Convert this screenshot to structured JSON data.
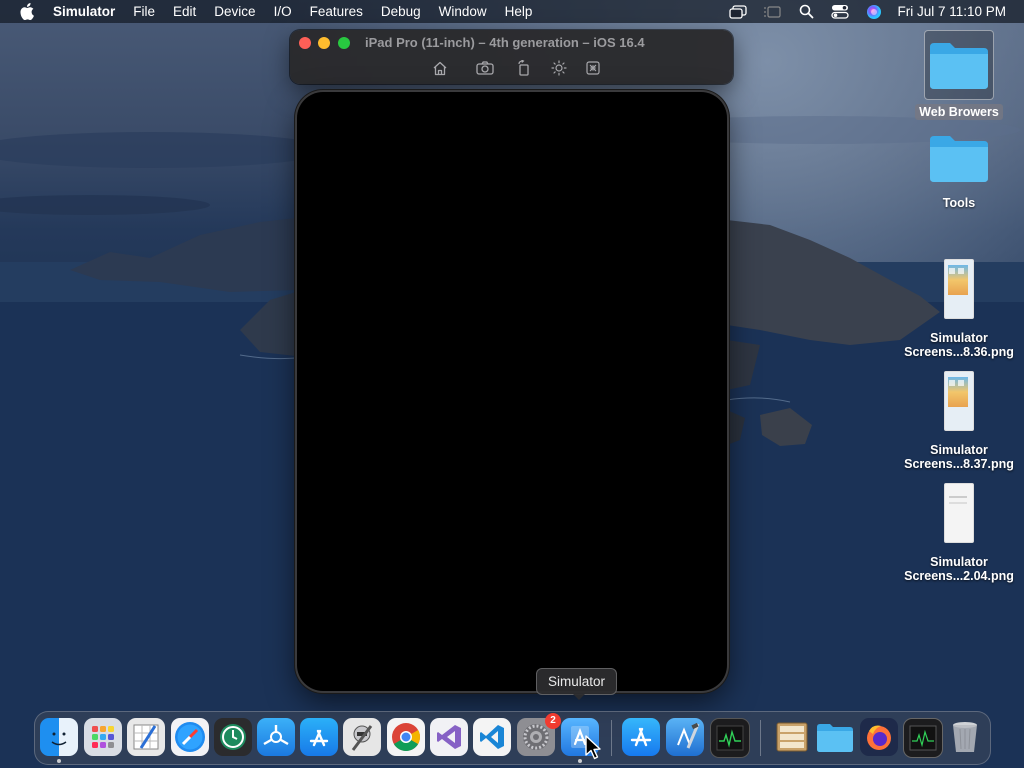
{
  "menubar": {
    "app_name": "Simulator",
    "items": [
      "File",
      "Edit",
      "Device",
      "I/O",
      "Features",
      "Debug",
      "Window",
      "Help"
    ],
    "clock": "Fri Jul 7  11:10 PM",
    "status_icons": [
      "screen-mirroring-icon",
      "stage-manager-icon",
      "spotlight-search-icon",
      "control-center-icon",
      "siri-icon"
    ]
  },
  "simulator": {
    "title": "iPad Pro (11-inch) – 4th generation – iOS 16.4",
    "toolbar_icons": [
      "home-icon",
      "screenshot-icon",
      "rotate-icon",
      "appearance-icon",
      "lock-icon"
    ]
  },
  "desktop": {
    "items": [
      {
        "label": "Web Browers",
        "kind": "folder",
        "selected": true
      },
      {
        "label": "Tools",
        "kind": "folder",
        "selected": false
      },
      {
        "label": "Simulator Screens...8.36.png",
        "line1": "Simulator",
        "line2": "Screens...8.36.png",
        "kind": "screenshot"
      },
      {
        "label": "Simulator Screens...8.37.png",
        "line1": "Simulator",
        "line2": "Screens...8.37.png",
        "kind": "screenshot"
      },
      {
        "label": "Simulator Screens...2.04.png",
        "line1": "Simulator",
        "line2": "Screens...2.04.png",
        "kind": "screenshot-blank"
      }
    ]
  },
  "tooltip": {
    "text": "Simulator"
  },
  "dock": {
    "apps": [
      {
        "icon": "finder-icon",
        "running": true
      },
      {
        "icon": "launchpad-icon",
        "running": false
      },
      {
        "icon": "script-editor-icon",
        "running": false
      },
      {
        "icon": "safari-icon",
        "running": false
      },
      {
        "icon": "time-machine-icon",
        "running": false
      },
      {
        "icon": "testflight-icon",
        "running": false
      },
      {
        "icon": "app-store-connect-icon",
        "running": false
      },
      {
        "icon": "automator-icon",
        "running": false
      },
      {
        "icon": "chrome-icon",
        "running": false
      },
      {
        "icon": "visual-studio-icon",
        "running": false
      },
      {
        "icon": "vscode-icon",
        "running": false
      },
      {
        "icon": "system-settings-icon",
        "running": false,
        "badge": "2"
      },
      {
        "icon": "simulator-icon",
        "running": true
      },
      {
        "icon": "app-store-icon",
        "running": false
      },
      {
        "icon": "xcode-icon",
        "running": false
      },
      {
        "icon": "activity-monitor-icon",
        "running": false
      },
      {
        "icon": "archive-utility-icon",
        "running": false
      },
      {
        "icon": "downloads-folder-icon",
        "running": false
      },
      {
        "icon": "firefox-icon",
        "running": false
      },
      {
        "icon": "console-icon",
        "running": false
      },
      {
        "icon": "trash-icon",
        "running": false
      }
    ]
  }
}
